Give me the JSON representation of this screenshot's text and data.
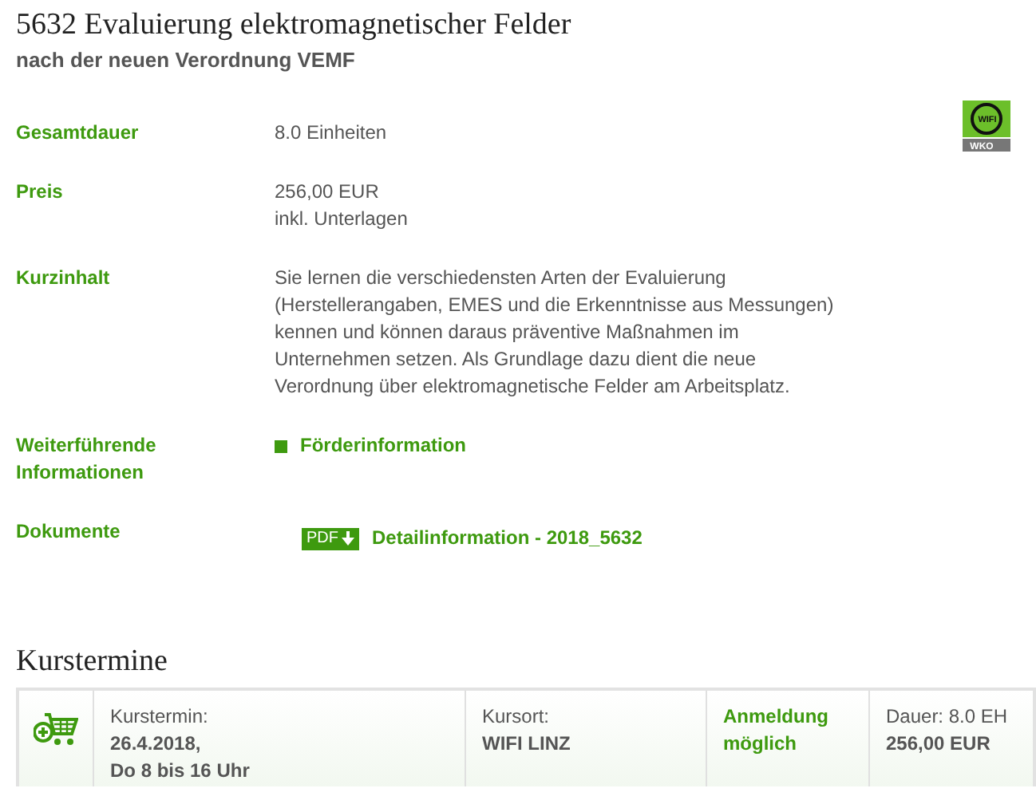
{
  "title": "5632 Evaluierung elektromagnetischer Felder",
  "subtitle": "nach der neuen Verordnung VEMF",
  "logo": {
    "top": "WIFI",
    "bottom": "WKO"
  },
  "details": [
    {
      "kind": "text",
      "label": "Gesamtdauer",
      "lines": [
        "8.0 Einheiten"
      ]
    },
    {
      "kind": "text",
      "label": "Preis",
      "lines": [
        "256,00 EUR",
        "inkl. Unterlagen"
      ]
    },
    {
      "kind": "text",
      "label": "Kurzinhalt",
      "lines": [
        "Sie lernen die verschiedensten Arten der Evaluierung",
        "(Herstellerangaben, EMES und die Erkenntnisse aus Messungen)",
        "kennen und können daraus präventive Maßnahmen im",
        "Unternehmen setzen. Als Grundlage dazu dient die neue",
        "Verordnung über elektromagnetische Felder am Arbeitsplatz."
      ]
    },
    {
      "kind": "link",
      "label": "Weiterführende Informationen",
      "link": "Förderinformation"
    },
    {
      "kind": "document",
      "label": "Dokumente",
      "badge": "PDF",
      "link": "Detailinformation - 2018_5632"
    }
  ],
  "dates_heading": "Kurstermine",
  "dates": [
    {
      "date_label": "Kurstermin:",
      "date_lines": [
        "26.4.2018,",
        "Do 8 bis 16 Uhr"
      ],
      "place_label": "Kursort:",
      "place": "WIFI LINZ",
      "status": "Anmeldung möglich",
      "duration": "Dauer: 8.0 EH",
      "price": "256,00 EUR"
    }
  ]
}
